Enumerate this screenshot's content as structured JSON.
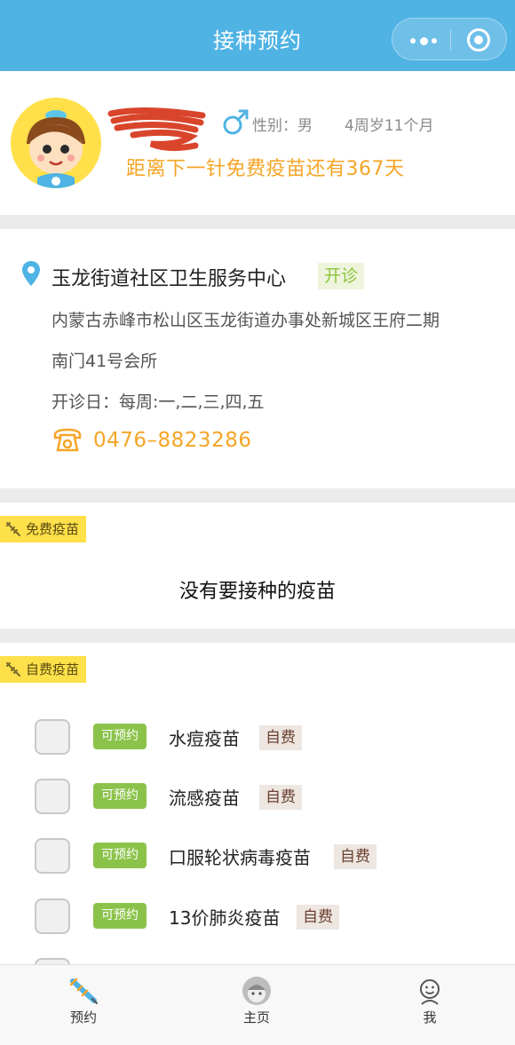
{
  "header": {
    "title": "接种预约"
  },
  "profile": {
    "gender": "性别：男",
    "age": "4周岁11个月",
    "countdown": "距离下一针免费疫苗还有367天"
  },
  "clinic": {
    "name": "玉龙街道社区卫生服务中心",
    "status": "开诊",
    "address_line1": "内蒙古赤峰市松山区玉龙街道办事处新城区王府二期",
    "address_line2": "南门41号会所",
    "open_days": "开诊日：每周:一,二,三,四,五",
    "phone": "0476–8823286"
  },
  "free_section": {
    "tag": "免费疫苗",
    "empty_text": "没有要接种的疫苗"
  },
  "self_section": {
    "tag": "自费疫苗",
    "items": [
      {
        "status": "可预约",
        "name": "水痘疫苗",
        "badge": "自费"
      },
      {
        "status": "可预约",
        "name": "流感疫苗",
        "badge": "自费"
      },
      {
        "status": "可预约",
        "name": "口服轮状病毒疫苗",
        "badge": "自费"
      },
      {
        "status": "可预约",
        "name": "13价肺炎疫苗",
        "badge": "自费"
      }
    ]
  },
  "nav": {
    "items": [
      {
        "label": "预约",
        "icon": "syringe-icon"
      },
      {
        "label": "主页",
        "icon": "baby-avatar-icon"
      },
      {
        "label": "我",
        "icon": "smiley-face-icon"
      }
    ]
  },
  "colors": {
    "header": "#4fb3e4",
    "accent_orange": "#f5a526",
    "available_green": "#8bc34a",
    "tag_yellow": "#fde04a"
  }
}
